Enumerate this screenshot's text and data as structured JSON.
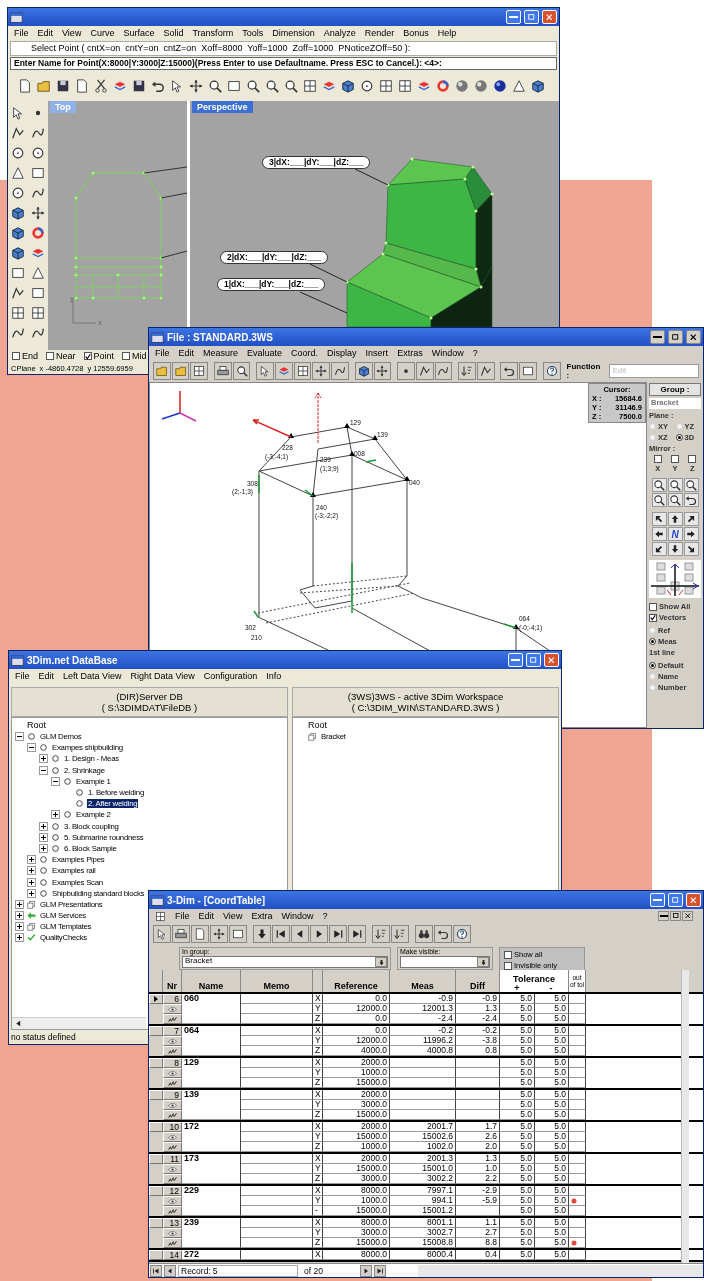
{
  "rhino_window": {
    "menu": [
      "File",
      "Edit",
      "View",
      "Curve",
      "Surface",
      "Solid",
      "Transform",
      "Tools",
      "Dimension",
      "Analyze",
      "Render",
      "Bonus",
      "Help"
    ],
    "command_line": "Select Point ( cntX=on  cntY=on  cntZ=on  Xoff=8000  Yoff=1000  Zoff=1000  PNoticeZOff=50 ):",
    "prompt": "Enter Name for Point(X:8000|Y:3000|Z:15000)(Press Enter to use Defaultname. Press ESC to Cancel.): <4>:",
    "viewports": [
      {
        "label": "Top",
        "selected": false
      },
      {
        "label": "Perspective",
        "selected": true
      }
    ],
    "axis_labels": [
      "y",
      "x"
    ],
    "point_labels": [
      "3|dX:___|dY:___|dZ:___",
      "2|dX:___|dY:___|dZ:___",
      "1|dX:___|dY:___|dZ:___"
    ],
    "osnaps": [
      {
        "label": "End",
        "checked": false
      },
      {
        "label": "Near",
        "checked": false
      },
      {
        "label": "Point",
        "checked": true
      },
      {
        "label": "Mid",
        "checked": false
      }
    ],
    "status": [
      "CPlane",
      "x -4860.4728",
      "y 12559.6959"
    ]
  },
  "measure_window": {
    "title": "File :  STANDARD.3WS",
    "menu": [
      "File",
      "Edit",
      "Measure",
      "Evaluate",
      "Coord.",
      "Display",
      "Insert",
      "Extras",
      "Window",
      "?"
    ],
    "function_label": "Function :",
    "function_value": "Edit",
    "point_labels": [
      "129",
      "139",
      "228",
      "(-3;-4;1)",
      "239",
      "(1;3;9)",
      "008",
      "040",
      "308",
      "(2;-1;3)",
      "240",
      "(-3;-2;2)",
      "302",
      "210",
      "064",
      "(-0;-4;1)"
    ],
    "cursor": {
      "title": "Cursor:",
      "rows": [
        {
          "axis": "X :",
          "value": "15684.6"
        },
        {
          "axis": "Y :",
          "value": "31146.9"
        },
        {
          "axis": "Z :",
          "value": "7500.0"
        }
      ]
    },
    "panel": {
      "group_button": "Group :",
      "group_value": "Bracket",
      "plane_title": "Plane :",
      "planes": [
        {
          "label": "XY",
          "selected": false
        },
        {
          "label": "YZ",
          "selected": false
        },
        {
          "label": "XZ",
          "selected": false
        },
        {
          "label": "3D",
          "selected": true
        }
      ],
      "mirror_title": "Mirror :",
      "mirror": [
        {
          "label": "X",
          "checked": false
        },
        {
          "label": "Y",
          "checked": false
        },
        {
          "label": "Z",
          "checked": false
        }
      ],
      "nav_center": "N",
      "show": [
        {
          "label": "Show All",
          "checked": false
        },
        {
          "label": "Vectors",
          "checked": true
        }
      ],
      "display": [
        {
          "label": "Ref",
          "selected": false
        },
        {
          "label": "Meas",
          "selected": true
        }
      ],
      "first_line_title": "1st line",
      "first_line": [
        {
          "label": "Default",
          "selected": true
        },
        {
          "label": "Name",
          "selected": false
        },
        {
          "label": "Number",
          "selected": false
        }
      ]
    }
  },
  "database_window": {
    "title": "3Dim.net DataBase",
    "menu": [
      "File",
      "Edit",
      "Left Data View",
      "Right Data View",
      "Configuration",
      "Info"
    ],
    "left_header": [
      "(DIR)Server DB",
      "( S:\\3DIMDAT\\FileDB )"
    ],
    "right_header": [
      "(3WS)3WS - active 3Dim Workspace",
      "( C:\\3DIM_WIN\\STANDARD.3WS )"
    ],
    "left_tree": {
      "root": "Root",
      "items": [
        {
          "label": "GLM Demos",
          "kind": "circle",
          "expanded": true,
          "selected": false,
          "children": [
            {
              "label": "Exampes shipbuilding",
              "kind": "circle",
              "expanded": true,
              "selected": false,
              "children": [
                {
                  "label": "1. Design - Meas",
                  "kind": "circle",
                  "expanded": false,
                  "selected": false
                },
                {
                  "label": "2. Shrinkage",
                  "kind": "circle",
                  "expanded": true,
                  "selected": false,
                  "children": [
                    {
                      "label": "Example 1",
                      "kind": "circle",
                      "expanded": true,
                      "selected": false,
                      "children": [
                        {
                          "label": "1. Before welding",
                          "kind": "circle",
                          "selected": false
                        },
                        {
                          "label": "2. After welding",
                          "kind": "circle",
                          "selected": true
                        }
                      ]
                    },
                    {
                      "label": "Example 2",
                      "kind": "circle",
                      "expanded": false,
                      "selected": false
                    }
                  ]
                },
                {
                  "label": "3. Block coupling",
                  "kind": "circle",
                  "expanded": false,
                  "selected": false
                },
                {
                  "label": "5. Submarine roundness",
                  "kind": "circle",
                  "expanded": false,
                  "selected": false
                },
                {
                  "label": "6. Block Sample",
                  "kind": "circle",
                  "expanded": false,
                  "selected": false
                }
              ]
            },
            {
              "label": "Examples Pipes",
              "kind": "circle",
              "expanded": false,
              "selected": false
            },
            {
              "label": "Examples rail",
              "kind": "circle",
              "expanded": false,
              "selected": false
            },
            {
              "label": "Examples Scan",
              "kind": "circle",
              "expanded": false,
              "selected": false
            },
            {
              "label": "Shipbuilding standard blocks",
              "kind": "circle",
              "expanded": false,
              "selected": false
            }
          ]
        },
        {
          "label": "GLM Presentations",
          "kind": "package",
          "expanded": false,
          "selected": false
        },
        {
          "label": "GLM Services",
          "kind": "arrow",
          "expanded": false,
          "selected": false
        },
        {
          "label": "GLM Templates",
          "kind": "package",
          "expanded": false,
          "selected": false
        },
        {
          "label": "QualityChecks",
          "kind": "check",
          "expanded": false,
          "selected": false
        }
      ]
    },
    "right_tree": {
      "root": "Root",
      "items": [
        {
          "label": "Bracket",
          "kind": "package",
          "selected": false
        }
      ]
    },
    "status": "no status defined"
  },
  "coord_window": {
    "title": "3-Dim - [CoordTable]",
    "menu": [
      "File",
      "Edit",
      "View",
      "Extra",
      "Window",
      "?"
    ],
    "group_label": "In group:",
    "group_value": "Bracket",
    "visible_label": "Make visible:",
    "checks": [
      {
        "label": "Show all",
        "checked": false
      },
      {
        "label": "Invisible only",
        "checked": false
      }
    ],
    "columns": [
      "Nr",
      "Name",
      "Memo",
      "Reference",
      "Meas",
      "Diff"
    ],
    "tolerance": "Tolerance",
    "tol_plus": "+",
    "tol_minus": "-",
    "out_label": "out of tol",
    "records": [
      {
        "nr": "6",
        "name": "060",
        "selected": true,
        "rows": [
          {
            "axis": "X",
            "reference": "0.0",
            "meas": "-0.9",
            "diff": "-0.9",
            "tol_plus": "5.0",
            "tol_minus": "5.0",
            "out": false
          },
          {
            "axis": "Y",
            "reference": "12000.0",
            "meas": "12001.3",
            "diff": "1.3",
            "tol_plus": "5.0",
            "tol_minus": "5.0",
            "out": false
          },
          {
            "axis": "Z",
            "reference": "0.0",
            "meas": "-2.4",
            "diff": "-2.4",
            "tol_plus": "5.0",
            "tol_minus": "5.0",
            "out": false
          }
        ]
      },
      {
        "nr": "7",
        "name": "064",
        "selected": false,
        "rows": [
          {
            "axis": "X",
            "reference": "0.0",
            "meas": "-0.2",
            "diff": "-0.2",
            "tol_plus": "5.0",
            "tol_minus": "5.0",
            "out": false
          },
          {
            "axis": "Y",
            "reference": "12000.0",
            "meas": "11996.2",
            "diff": "-3.8",
            "tol_plus": "5.0",
            "tol_minus": "5.0",
            "out": false
          },
          {
            "axis": "Z",
            "reference": "4000.0",
            "meas": "4000.8",
            "diff": "0.8",
            "tol_plus": "5.0",
            "tol_minus": "5.0",
            "out": false
          }
        ]
      },
      {
        "nr": "8",
        "name": "129",
        "selected": false,
        "rows": [
          {
            "axis": "X",
            "reference": "2000.0",
            "tol_plus": "5.0",
            "tol_minus": "5.0",
            "out": false
          },
          {
            "axis": "Y",
            "reference": "1000.0",
            "tol_plus": "5.0",
            "tol_minus": "5.0",
            "out": false
          },
          {
            "axis": "Z",
            "reference": "15000.0",
            "tol_plus": "5.0",
            "tol_minus": "5.0",
            "out": false
          }
        ]
      },
      {
        "nr": "9",
        "name": "139",
        "selected": false,
        "rows": [
          {
            "axis": "X",
            "reference": "2000.0",
            "tol_plus": "5.0",
            "tol_minus": "5.0",
            "out": false
          },
          {
            "axis": "Y",
            "reference": "3000.0",
            "tol_plus": "5.0",
            "tol_minus": "5.0",
            "out": false
          },
          {
            "axis": "Z",
            "reference": "15000.0",
            "tol_plus": "5.0",
            "tol_minus": "5.0",
            "out": false
          }
        ]
      },
      {
        "nr": "10",
        "name": "172",
        "selected": false,
        "rows": [
          {
            "axis": "X",
            "reference": "2000.0",
            "meas": "2001.7",
            "diff": "1.7",
            "tol_plus": "5.0",
            "tol_minus": "5.0",
            "out": false
          },
          {
            "axis": "Y",
            "reference": "15000.0",
            "meas": "15002.6",
            "diff": "2.6",
            "tol_plus": "5.0",
            "tol_minus": "5.0",
            "out": false
          },
          {
            "axis": "Z",
            "reference": "1000.0",
            "meas": "1002.0",
            "diff": "2.0",
            "tol_plus": "5.0",
            "tol_minus": "5.0",
            "out": false
          }
        ]
      },
      {
        "nr": "11",
        "name": "173",
        "selected": false,
        "rows": [
          {
            "axis": "X",
            "reference": "2000.0",
            "meas": "2001.3",
            "diff": "1.3",
            "tol_plus": "5.0",
            "tol_minus": "5.0",
            "out": false
          },
          {
            "axis": "Y",
            "reference": "15000.0",
            "meas": "15001.0",
            "diff": "1.0",
            "tol_plus": "5.0",
            "tol_minus": "5.0",
            "out": false
          },
          {
            "axis": "Z",
            "reference": "3000.0",
            "meas": "3002.2",
            "diff": "2.2",
            "tol_plus": "5.0",
            "tol_minus": "5.0",
            "out": false
          }
        ]
      },
      {
        "nr": "12",
        "name": "229",
        "selected": false,
        "rows": [
          {
            "axis": "X",
            "reference": "8000.0",
            "meas": "7997.1",
            "diff": "-2.9",
            "tol_plus": "5.0",
            "tol_minus": "5.0",
            "out": false
          },
          {
            "axis": "Y",
            "reference": "1000.0",
            "meas": "994.1",
            "diff": "-5.9",
            "tol_plus": "5.0",
            "tol_minus": "5.0",
            "out": true
          },
          {
            "axis": "-",
            "reference": "15000.0",
            "meas": "15001.2",
            "tol_plus": "5.0",
            "tol_minus": "5.0",
            "out": false
          }
        ]
      },
      {
        "nr": "13",
        "name": "239",
        "selected": false,
        "rows": [
          {
            "axis": "X",
            "reference": "8000.0",
            "meas": "8001.1",
            "diff": "1.1",
            "tol_plus": "5.0",
            "tol_minus": "5.0",
            "out": false
          },
          {
            "axis": "Y",
            "reference": "3000.0",
            "meas": "3002.7",
            "diff": "2.7",
            "tol_plus": "5.0",
            "tol_minus": "5.0",
            "out": false
          },
          {
            "axis": "Z",
            "reference": "15000.0",
            "meas": "15008.8",
            "diff": "8.8",
            "tol_plus": "5.0",
            "tol_minus": "5.0",
            "out": true
          }
        ]
      },
      {
        "nr": "14",
        "name": "272",
        "selected": false,
        "rows": [
          {
            "axis": "X",
            "reference": "8000.0",
            "meas": "8000.4",
            "diff": "0.4",
            "tol_plus": "5.0",
            "tol_minus": "5.0",
            "out": false
          }
        ]
      }
    ],
    "record_label": "Record:",
    "record_value": "5",
    "record_total": "of 20"
  }
}
